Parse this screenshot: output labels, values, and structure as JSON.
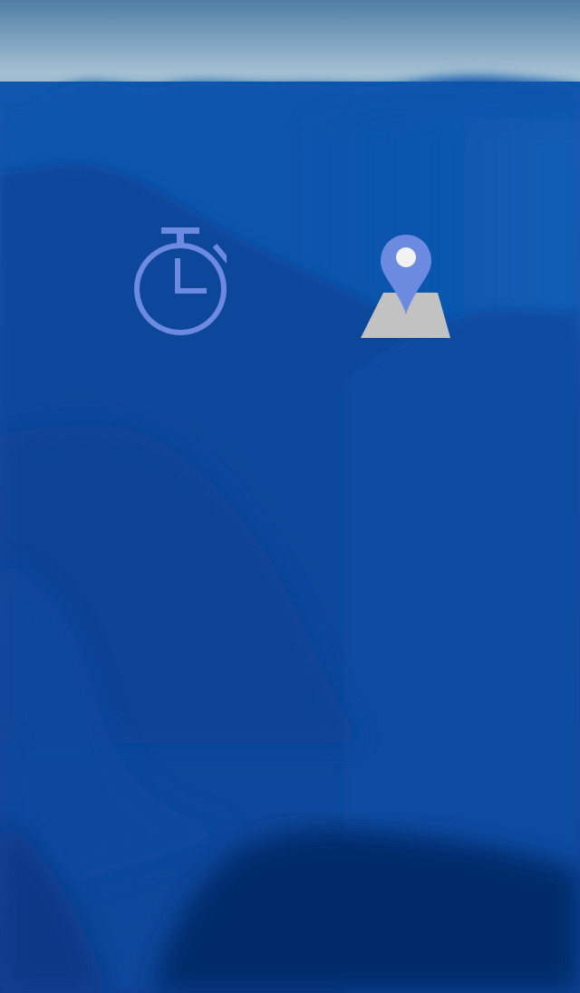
{
  "colors": {
    "sky_top": "#5a87ad",
    "sky_haze": "#9cb9cc",
    "ridge_far": "#0d4ea8",
    "ridge_mid": "#0a4aa0",
    "ridge_near": "#093f91",
    "foreground_dark": "#052a66",
    "icon_accent": "#6b8ae0",
    "map_base": "#c2c2c2",
    "pin_dot": "#f2f2f2"
  },
  "icons": {
    "timer": "stopwatch-icon",
    "map": "map-pin-icon"
  }
}
